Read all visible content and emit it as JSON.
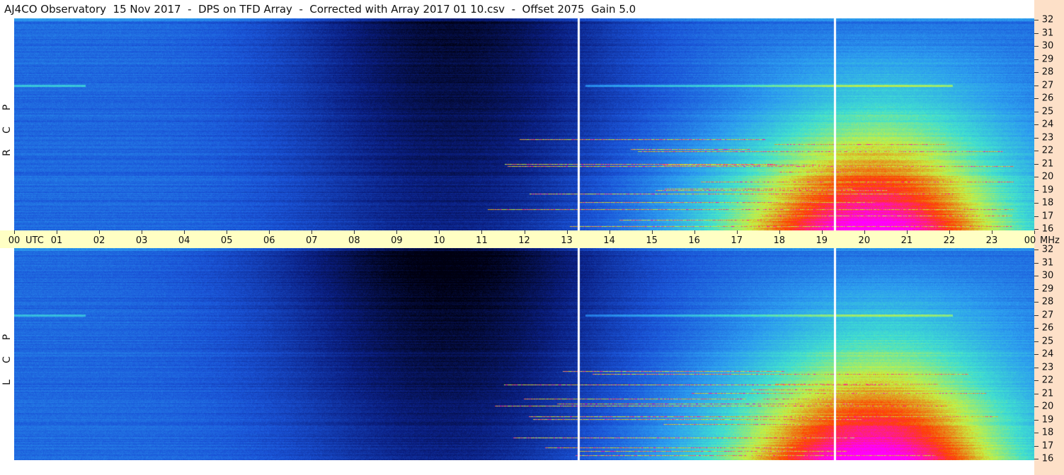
{
  "title": "AJ4CO Observatory  15 Nov 2017  -  DPS on TFD Array  -  Corrected with Array 2017 01 10.csv  -  Offset 2075  Gain 5.0",
  "chart_data": [
    {
      "type": "heatmap",
      "panel": "RCP",
      "polarization_letters": [
        "R",
        "C",
        "P"
      ],
      "x_axis": {
        "unit": "UTC",
        "ticks": [
          "00",
          "01",
          "02",
          "03",
          "04",
          "05",
          "06",
          "07",
          "08",
          "09",
          "10",
          "11",
          "12",
          "13",
          "14",
          "15",
          "16",
          "17",
          "18",
          "19",
          "20",
          "21",
          "22",
          "23",
          "00"
        ]
      },
      "y_axis": {
        "unit": "MHz",
        "range": [
          16,
          32
        ],
        "ticks": [
          16,
          17,
          18,
          19,
          20,
          21,
          22,
          23,
          24,
          25,
          26,
          27,
          28,
          29,
          30,
          31,
          32
        ]
      },
      "colormap": [
        "#000010",
        "#0a1e80",
        "#1a54d8",
        "#2c9cf0",
        "#40e0d0",
        "#c8f040",
        "#ff4000",
        "#ff00ff"
      ]
    },
    {
      "type": "heatmap",
      "panel": "LCP",
      "polarization_letters": [
        "L",
        "C",
        "P"
      ],
      "x_axis": {
        "unit": "UTC",
        "ticks": [
          "00",
          "01",
          "02",
          "03",
          "04",
          "05",
          "06",
          "07",
          "08",
          "09",
          "10",
          "11",
          "12",
          "13",
          "14",
          "15",
          "16",
          "17",
          "18",
          "19",
          "20",
          "21",
          "22",
          "23",
          "00"
        ]
      },
      "y_axis": {
        "unit": "MHz",
        "range": [
          16,
          32
        ],
        "ticks": [
          16,
          17,
          18,
          19,
          20,
          21,
          22,
          23,
          24,
          25,
          26,
          27,
          28,
          29,
          30,
          31,
          32
        ]
      },
      "colormap": [
        "#000010",
        "#0a1e80",
        "#1a54d8",
        "#2c9cf0",
        "#40e0d0",
        "#c8f040",
        "#ff4000",
        "#ff00ff"
      ]
    }
  ],
  "time_axis": {
    "utc_label": "UTC",
    "mhz_label": "MHz"
  },
  "colors": {
    "time_axis_bg": "#ffffc4",
    "right_strip_bg": "#fde0c8"
  }
}
